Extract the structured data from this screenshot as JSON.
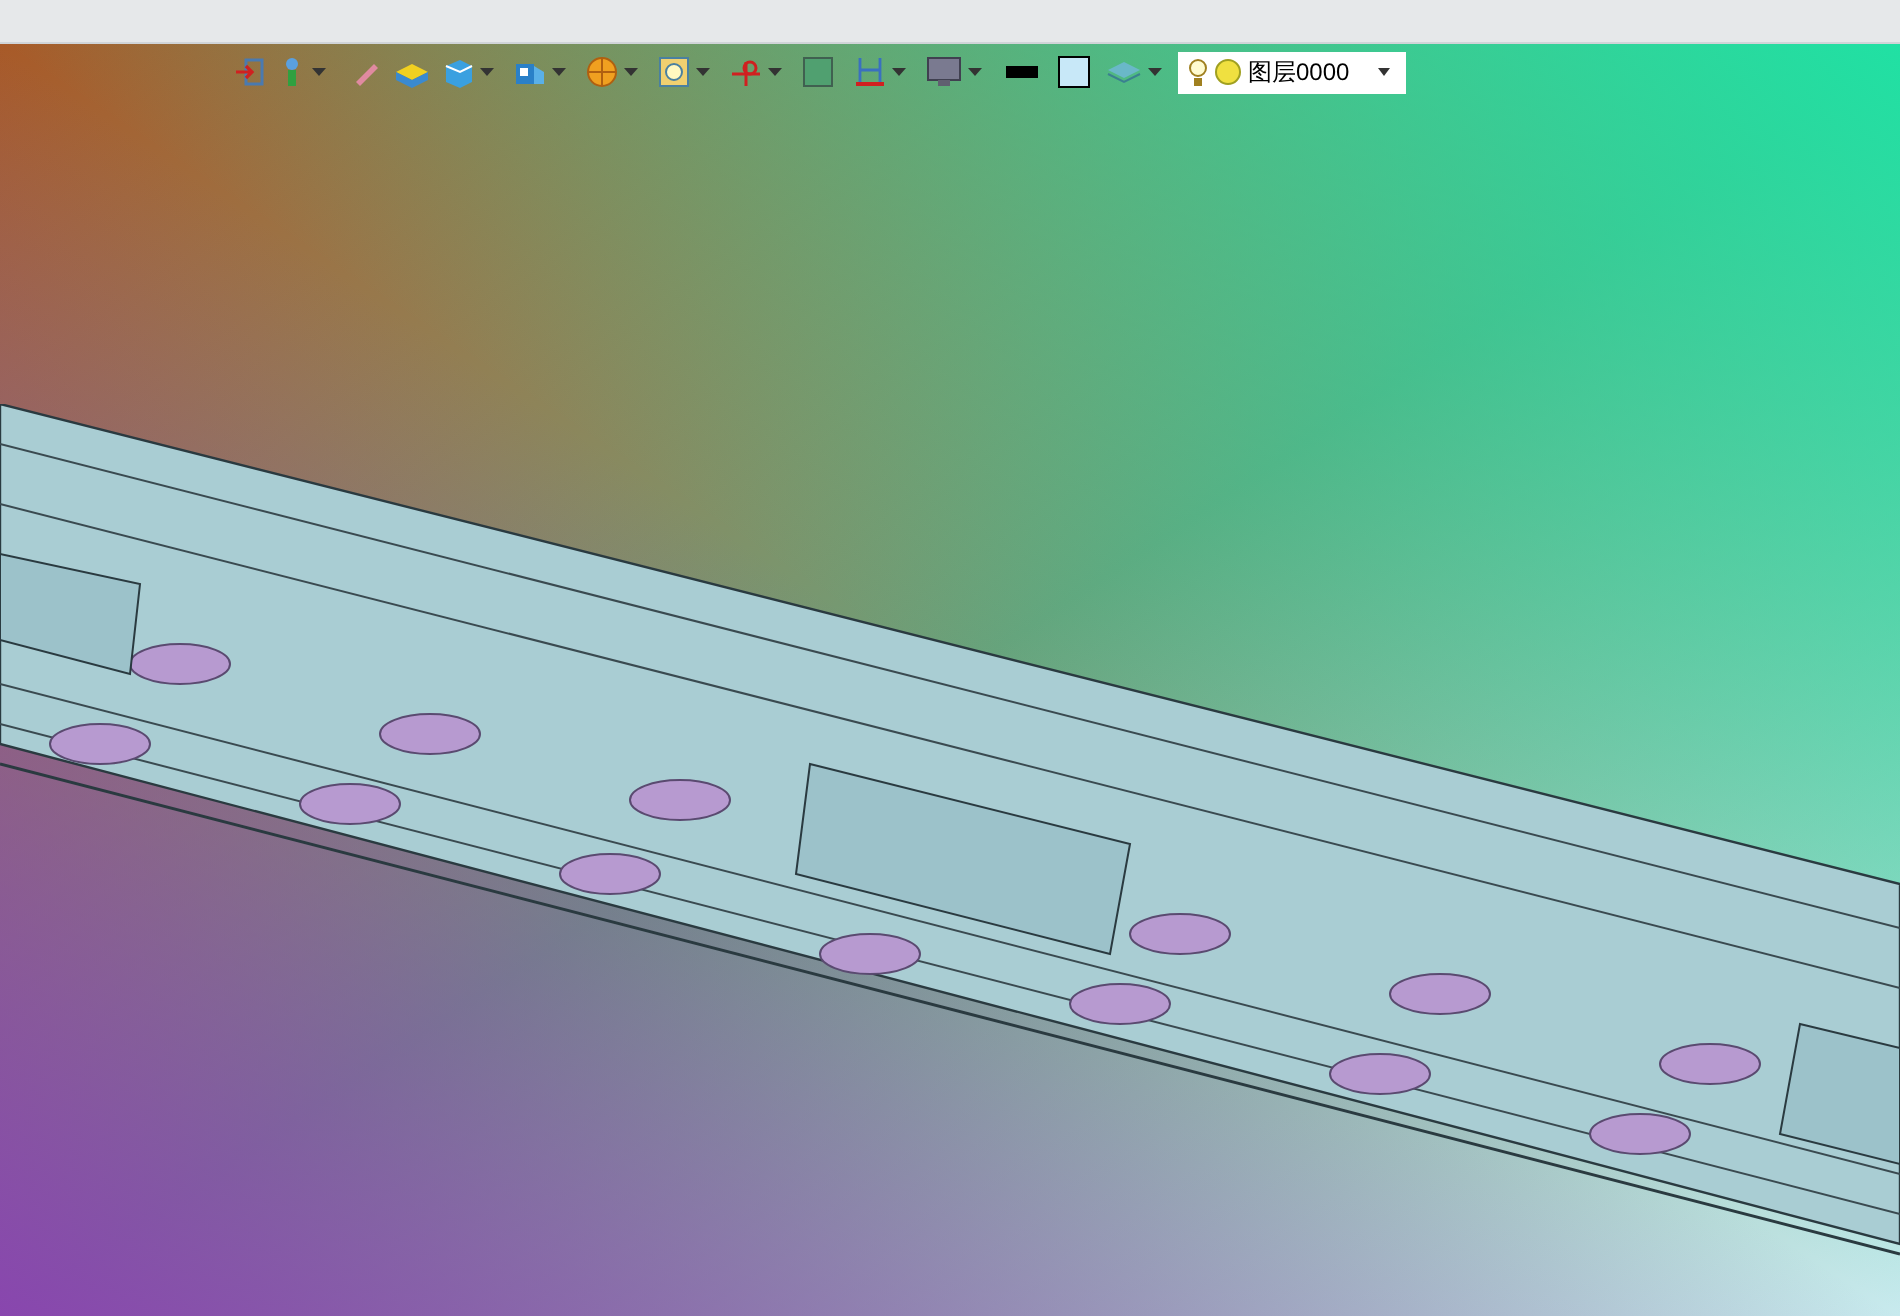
{
  "layer_selector": {
    "label": "图层0000"
  }
}
